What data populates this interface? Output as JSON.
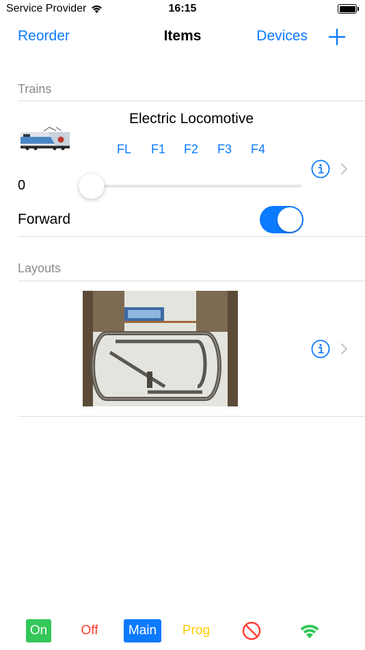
{
  "status_bar": {
    "carrier": "Service Provider",
    "time": "16:15",
    "battery_level": 1.0
  },
  "nav": {
    "left_button": "Reorder",
    "title": "Items",
    "right_button": "Devices",
    "add_icon": "plus-icon"
  },
  "trains_section": {
    "header": "Trains",
    "items": [
      {
        "name": "Electric Locomotive",
        "functions": [
          "FL",
          "F1",
          "F2",
          "F3",
          "F4"
        ],
        "speed_value": "0",
        "speed_level": 0,
        "direction_label": "Forward",
        "direction_on": true
      }
    ]
  },
  "layouts_section": {
    "header": "Layouts"
  },
  "bottom_bar": {
    "on_label": "On",
    "off_label": "Off",
    "main_label": "Main",
    "prog_label": "Prog",
    "stop_icon": "prohibited-icon",
    "wifi_icon": "wifi-icon"
  },
  "colors": {
    "accent": "#0a7aff",
    "on": "#34c759",
    "off": "#ff3b30",
    "prog": "#ffcc00"
  }
}
